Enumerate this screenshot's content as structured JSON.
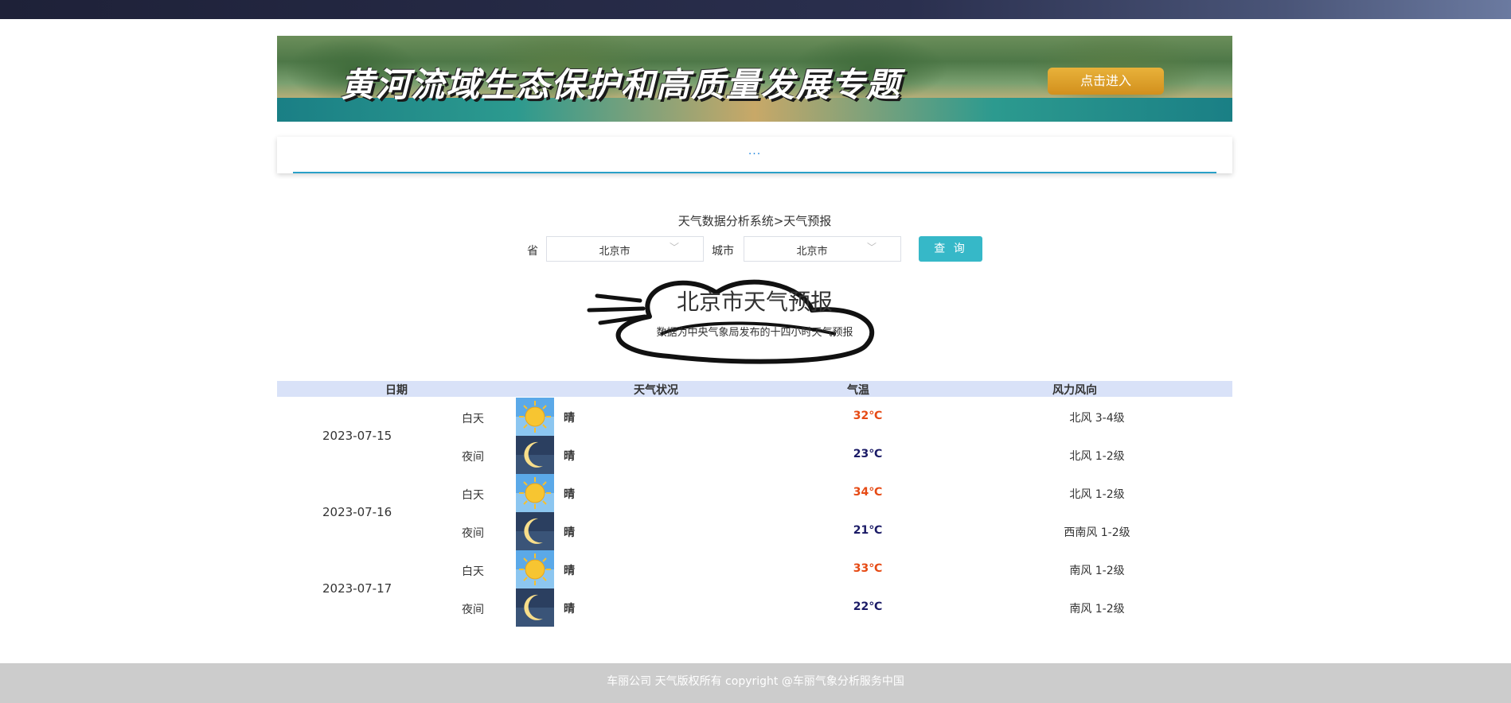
{
  "banner": {
    "title": "黄河流域生态保护和高质量发展专题",
    "button": "点击进入"
  },
  "nav": {
    "placeholder_dots": "..."
  },
  "breadcrumb": "天气数据分析系统>天气预报",
  "filters": {
    "province_label": "省",
    "province_value": "北京市",
    "city_label": "城市",
    "city_value": "北京市",
    "query_button": "查 询"
  },
  "forecast": {
    "title": "北京市天气预报",
    "subtitle": "数据为中央气象局发布的十四小时天气预报"
  },
  "table": {
    "headers": [
      "日期",
      "天气状况",
      "气温",
      "风力风向"
    ],
    "days": [
      {
        "date": "2023-07-15",
        "rows": [
          {
            "period": "白天",
            "icon": "sun-icon",
            "condition": "晴",
            "temp": "32℃",
            "wind": "北风 3-4级"
          },
          {
            "period": "夜间",
            "icon": "moon-icon",
            "condition": "晴",
            "temp": "23℃",
            "wind": "北风 1-2级"
          }
        ]
      },
      {
        "date": "2023-07-16",
        "rows": [
          {
            "period": "白天",
            "icon": "sun-icon",
            "condition": "晴",
            "temp": "34℃",
            "wind": "北风 1-2级"
          },
          {
            "period": "夜间",
            "icon": "moon-icon",
            "condition": "晴",
            "temp": "21℃",
            "wind": "西南风 1-2级"
          }
        ]
      },
      {
        "date": "2023-07-17",
        "rows": [
          {
            "period": "白天",
            "icon": "sun-icon",
            "condition": "晴",
            "temp": "33℃",
            "wind": "南风 1-2级"
          },
          {
            "period": "夜间",
            "icon": "moon-icon",
            "condition": "晴",
            "temp": "22℃",
            "wind": "南风 1-2级"
          }
        ]
      }
    ]
  },
  "footer": "车丽公司 天气版权所有 copyright @车丽气象分析服务中国",
  "colors": {
    "day_temp": "#e64a14",
    "night_temp": "#1a1a66",
    "header_bg": "#d9e2f8",
    "query_button": "#36b8c8",
    "footer_bg": "#cccccc"
  }
}
